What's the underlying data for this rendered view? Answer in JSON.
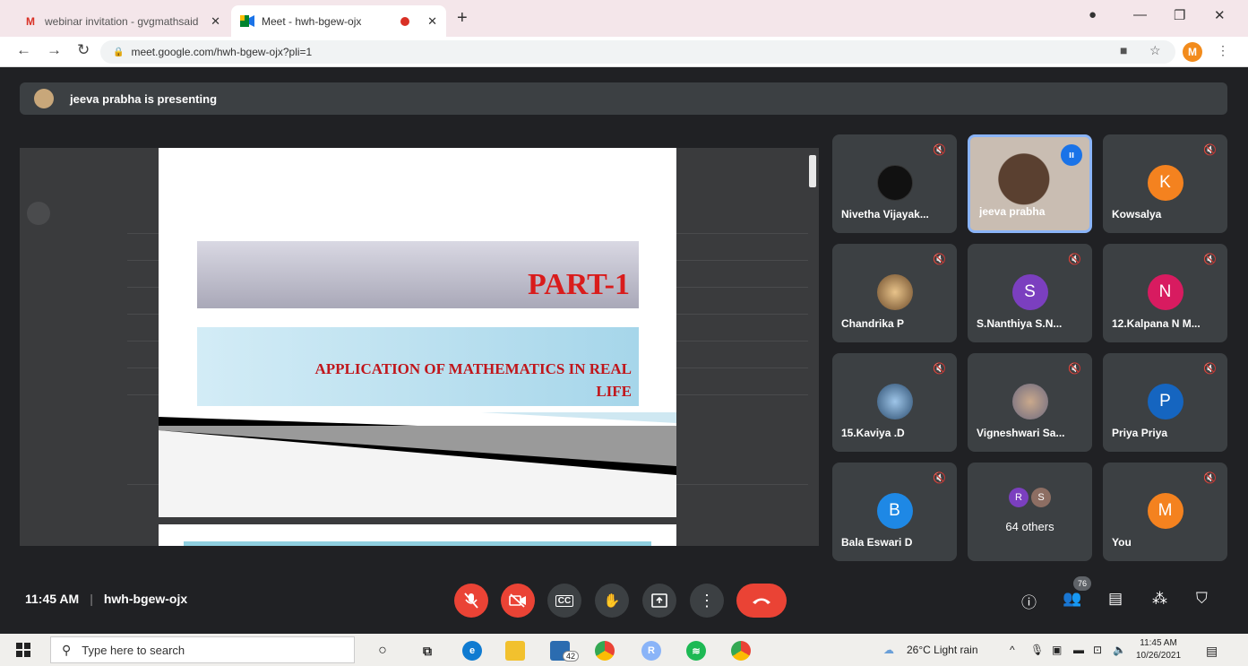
{
  "browser": {
    "tabs": [
      {
        "icon": "gmail-icon",
        "title": "webinar invitation - gvgmathsaid",
        "active": false
      },
      {
        "icon": "meet-icon",
        "title": "Meet - hwh-bgew-ojx",
        "active": true
      }
    ],
    "url": "meet.google.com/hwh-bgew-ojx?pli=1",
    "profile_initial": "M",
    "close_glyph": "✕",
    "new_tab_glyph": "+"
  },
  "meet": {
    "presenting_text": "jeeva prabha is presenting",
    "slide": {
      "title": "PART-1",
      "subtitle_line1": "APPLICATION OF MATHEMATICS IN REAL",
      "subtitle_line2": "LIFE"
    },
    "participants": [
      {
        "name": "Nivetha Vijayak...",
        "avatar_type": "image",
        "muted": true
      },
      {
        "name": "jeeva prabha",
        "avatar_type": "video",
        "muted": false,
        "speaking": true
      },
      {
        "name": "Kowsalya",
        "initial": "K",
        "color": "#f4821f",
        "muted": true
      },
      {
        "name": "Chandrika P",
        "avatar_type": "image",
        "muted": true
      },
      {
        "name": "S.Nanthiya S.N...",
        "initial": "S",
        "color": "#7b3fbf",
        "muted": true
      },
      {
        "name": "12.Kalpana N M...",
        "initial": "N",
        "color": "#d81b60",
        "muted": true
      },
      {
        "name": "15.Kaviya .D",
        "avatar_type": "image",
        "muted": true
      },
      {
        "name": "Vigneshwari Sa...",
        "avatar_type": "image",
        "muted": true
      },
      {
        "name": "Priya Priya",
        "initial": "P",
        "color": "#1565c0",
        "muted": true
      },
      {
        "name": "Bala Eswari D",
        "initial": "B",
        "color": "#1e88e5",
        "muted": true
      },
      {
        "name": "64 others",
        "others_initials": [
          "R",
          "S"
        ],
        "muted": false
      },
      {
        "name": "You",
        "initial": "M",
        "color": "#f4821f",
        "muted": true
      }
    ],
    "bottom": {
      "time": "11:45 AM",
      "separator": "|",
      "meeting_code": "hwh-bgew-ojx",
      "people_count": "76",
      "captions_label": "CC"
    }
  },
  "taskbar": {
    "search_placeholder": "Type here to search",
    "mail_badge": "42",
    "weather": "26°C  Light rain",
    "time": "11:45 AM",
    "date": "10/26/2021"
  }
}
